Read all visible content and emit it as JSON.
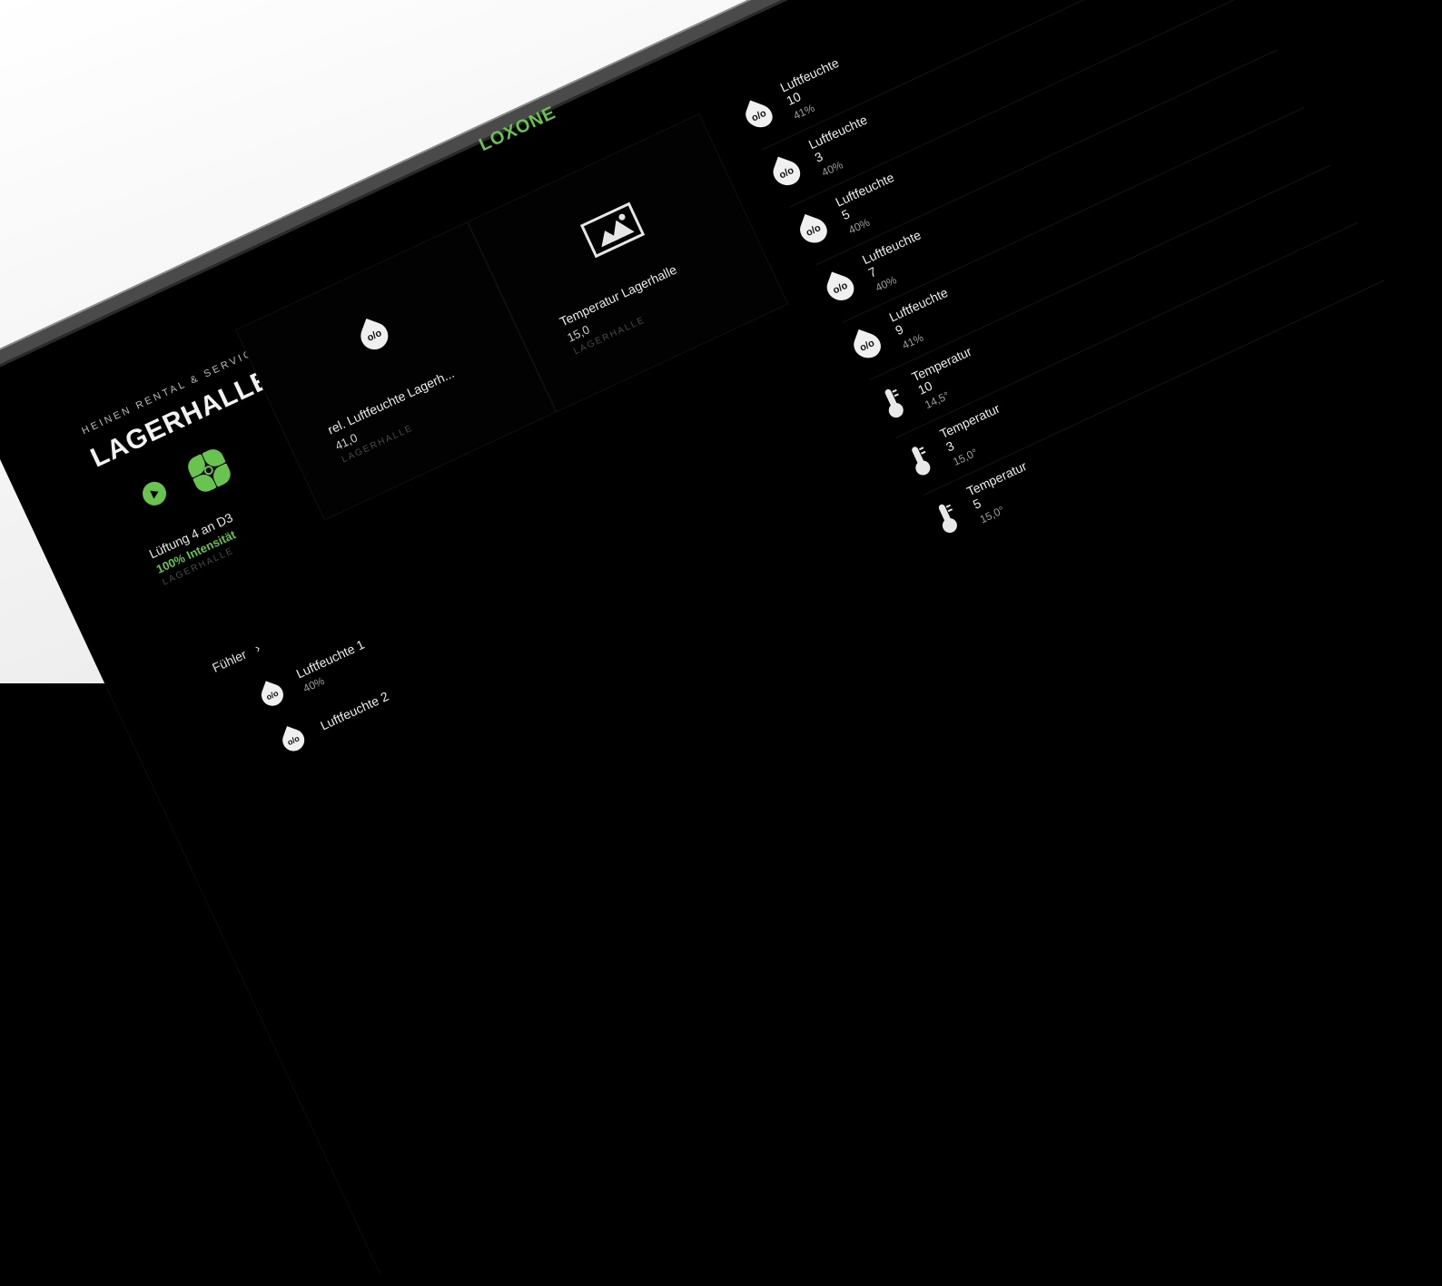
{
  "brand": {
    "logo": "LOXONE",
    "accent_color": "#69c34f"
  },
  "header": {
    "company": "HEINEN RENTAL & SERVICE GMBH",
    "room": "LAGERHALLE"
  },
  "ventilation": {
    "name": "Lüftung 4 an D3",
    "state": "100% Intensität",
    "room": "LAGERHALLE",
    "icons": [
      "play-icon",
      "fan-icon"
    ]
  },
  "section": {
    "label": "Fühler",
    "chevron": "›"
  },
  "tiles": [
    {
      "icon": "humidity-drop-icon",
      "icon_text": "o/o",
      "name": "rel. Luftfeuchte Lagerh...",
      "value": "41,0",
      "room": "LAGERHALLE"
    },
    {
      "icon": "picture-icon",
      "name": "Temperatur Lagerhalle",
      "value": "15,0",
      "room": "LAGERHALLE"
    }
  ],
  "sensor_list": [
    {
      "icon": "humidity-drop-icon",
      "icon_text": "o/o",
      "name": "Luftfeuchte 10",
      "value": "41%"
    },
    {
      "icon": "humidity-drop-icon",
      "icon_text": "o/o",
      "name": "Luftfeuchte 3",
      "value": "40%"
    },
    {
      "icon": "humidity-drop-icon",
      "icon_text": "o/o",
      "name": "Luftfeuchte 5",
      "value": "40%"
    },
    {
      "icon": "humidity-drop-icon",
      "icon_text": "o/o",
      "name": "Luftfeuchte 7",
      "value": "40%"
    },
    {
      "icon": "humidity-drop-icon",
      "icon_text": "o/o",
      "name": "Luftfeuchte 9",
      "value": "41%"
    },
    {
      "icon": "thermometer-icon",
      "name": "Temperatur 10",
      "value": "14,5°"
    },
    {
      "icon": "thermometer-icon",
      "name": "Temperatur 3",
      "value": "15,0°"
    },
    {
      "icon": "thermometer-icon",
      "name": "Temperatur 5",
      "value": "15,0°"
    }
  ],
  "lower_list": [
    {
      "icon": "humidity-drop-icon",
      "icon_text": "o/o",
      "name": "Luftfeuchte 1",
      "value": "40%"
    },
    {
      "icon": "humidity-drop-icon",
      "icon_text": "o/o",
      "name": "Luftfeuchte 2",
      "value": ""
    }
  ]
}
